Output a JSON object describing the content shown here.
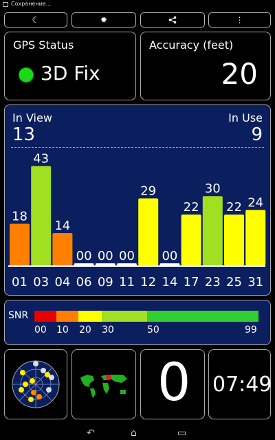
{
  "status_bar": {
    "text": "Сохранение..."
  },
  "toolbar": {
    "night_mode_icon": "☾",
    "brightness_icon": "✹",
    "share_icon": "<",
    "menu_icon": "⋮"
  },
  "gps_status": {
    "title": "GPS Status",
    "value": "3D Fix",
    "indicator_color": "#19d919"
  },
  "accuracy": {
    "title": "Accuracy (feet)",
    "value": "20"
  },
  "satellites": {
    "in_view_label": "In View",
    "in_view_count": "13",
    "in_use_label": "In Use",
    "in_use_count": "9"
  },
  "chart_data": {
    "type": "bar",
    "categories": [
      "01",
      "03",
      "04",
      "06",
      "09",
      "11",
      "12",
      "14",
      "17",
      "23",
      "25",
      "31"
    ],
    "values": [
      18,
      43,
      14,
      0,
      0,
      0,
      29,
      0,
      22,
      30,
      22,
      24
    ],
    "value_labels": [
      "18",
      "43",
      "14",
      "00",
      "00",
      "00",
      "29",
      "00",
      "22",
      "30",
      "22",
      "24"
    ],
    "ylim": [
      0,
      50
    ]
  },
  "snr": {
    "label": "SNR",
    "ticks": [
      "00",
      "10",
      "20",
      "30",
      "50",
      "99"
    ],
    "colors": [
      "#e60000",
      "#ff8000",
      "#ffff00",
      "#a0e020",
      "#30d030"
    ]
  },
  "map": {
    "marker_color": "#e02020"
  },
  "distance": {
    "value": "0"
  },
  "clock": {
    "time": "07:49"
  },
  "nav": {
    "back_icon": "↶",
    "home_icon": "⌂",
    "recent_icon": "▭"
  }
}
